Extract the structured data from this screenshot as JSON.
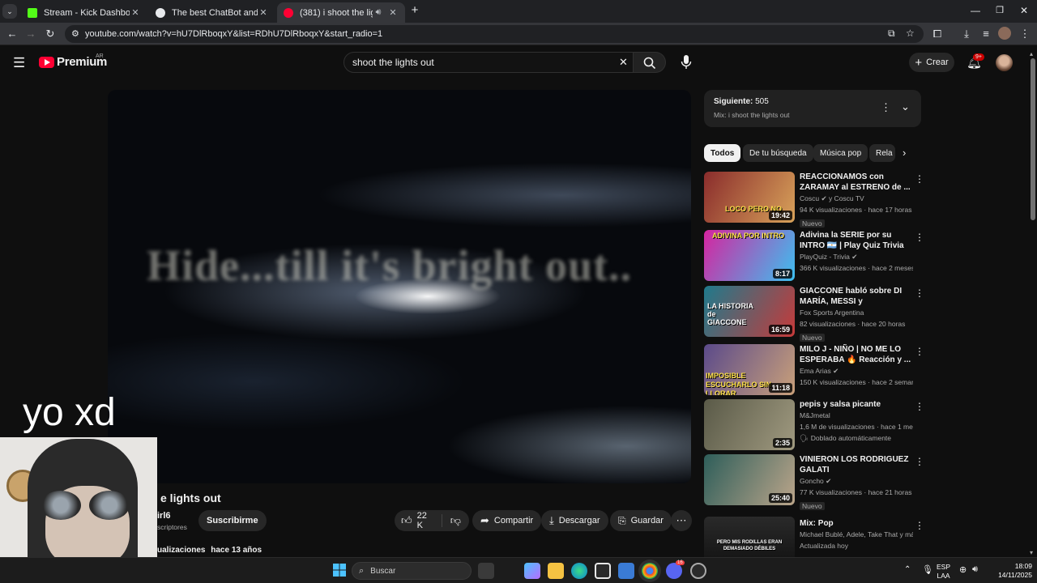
{
  "browser": {
    "tabs": [
      {
        "title": "Stream - Kick Dashboard",
        "favicon_color": "#53fc18"
      },
      {
        "title": "The best ChatBot and Widgets",
        "favicon_color": "#e8eaed"
      },
      {
        "title": "(381) i shoot the lights out",
        "favicon_color": "#ff0033"
      }
    ],
    "url": "youtube.com/watch?v=hU7DlRboqxY&list=RDhU7DlRboqxY&start_radio=1"
  },
  "youtube": {
    "logo": "Premium",
    "region": "AR",
    "search_query": "shoot the lights out",
    "create_label": "Crear",
    "notifications": "9+"
  },
  "video": {
    "lyric": "Hide...till it's bright out..",
    "title_visible": "e lights out",
    "channel_visible": "irl6",
    "subs_visible": "scriptores",
    "subscribe": "Suscribirme",
    "likes": "22 K",
    "share": "Compartir",
    "download": "Descargar",
    "save": "Guardar",
    "views_visible": "ualizaciones",
    "age": "hace 13 años"
  },
  "overlay": {
    "caption": "yo xd"
  },
  "sidebar": {
    "next_label": "Siguiente:",
    "next_count": "505",
    "mix_name": "Mix: i shoot the lights out",
    "chips": [
      "Todos",
      "De tu búsqueda",
      "Música pop",
      "Rela"
    ],
    "items": [
      {
        "title": "REACCIONAMOS con ZARAMAY al ESTRENO de ...",
        "channel": "Coscu ✔ y Coscu TV",
        "meta": "94 K visualizaciones · hace 17 horas",
        "badge": "Nuevo",
        "duration": "19:42",
        "thumb_text": "LOCO PERO NO",
        "c1": "#8a2c2c",
        "c2": "#d8a25a"
      },
      {
        "title": "Adivina la SERIE por su INTRO 🇦🇷 | Play Quiz Trivia",
        "channel": "PlayQuiz - Trivia ✔",
        "meta": "366 K visualizaciones · hace 2 meses",
        "badge": "",
        "duration": "8:17",
        "thumb_text": "ADIVINA POR INTRO",
        "c1": "#d6249f",
        "c2": "#3cc0f0"
      },
      {
        "title": "GIACCONE habló sobre DI MARÍA, MESSI y ARGENTINOS...",
        "channel": "Fox Sports Argentina",
        "meta": "82 visualizaciones · hace 20 horas",
        "badge": "Nuevo",
        "duration": "16:59",
        "thumb_text": "LA HISTORIA de GIACCONE",
        "c1": "#1f7a8c",
        "c2": "#c63a3a"
      },
      {
        "title": "MILO J - NIÑO | NO ME LO ESPERABA 🔥 Reacción y ...",
        "channel": "Ema Arias ✔",
        "meta": "150 K visualizaciones · hace 2 semanas",
        "badge": "",
        "duration": "11:18",
        "thumb_text": "IMPOSIBLE ESCUCHARLO SIN LLORAR",
        "c1": "#5b4a8a",
        "c2": "#c9a07a"
      },
      {
        "title": "pepis y salsa picante",
        "channel": "M&Jmetal",
        "meta": "1,6 M de visualizaciones · hace 1 mes",
        "badge": "Doblado automáticamente",
        "duration": "2:35",
        "thumb_text": "",
        "c1": "#5a5a48",
        "c2": "#a09a80"
      },
      {
        "title": "VINIERON LOS RODRIGUEZ GALATI",
        "channel": "Goncho ✔",
        "meta": "77 K visualizaciones · hace 21 horas",
        "badge": "Nuevo",
        "duration": "25:40",
        "thumb_text": "",
        "c1": "#2e5e5a",
        "c2": "#bba58a"
      },
      {
        "title": "Mix: Pop",
        "channel": "Michael Bublé, Adele, Take That y más",
        "meta": "Actualizada hoy",
        "badge": "",
        "duration": "",
        "thumb_text": "PERO MIS RODILLAS ERAN DEMASIADO DÉBILES",
        "c1": "#1a1a1a",
        "c2": "#3a3a3a"
      }
    ]
  },
  "taskbar": {
    "search": "Buscar",
    "lang_top": "ESP",
    "lang_bottom": "LAA",
    "time": "18:09",
    "date": "14/11/2025",
    "discord_badge": "16"
  }
}
